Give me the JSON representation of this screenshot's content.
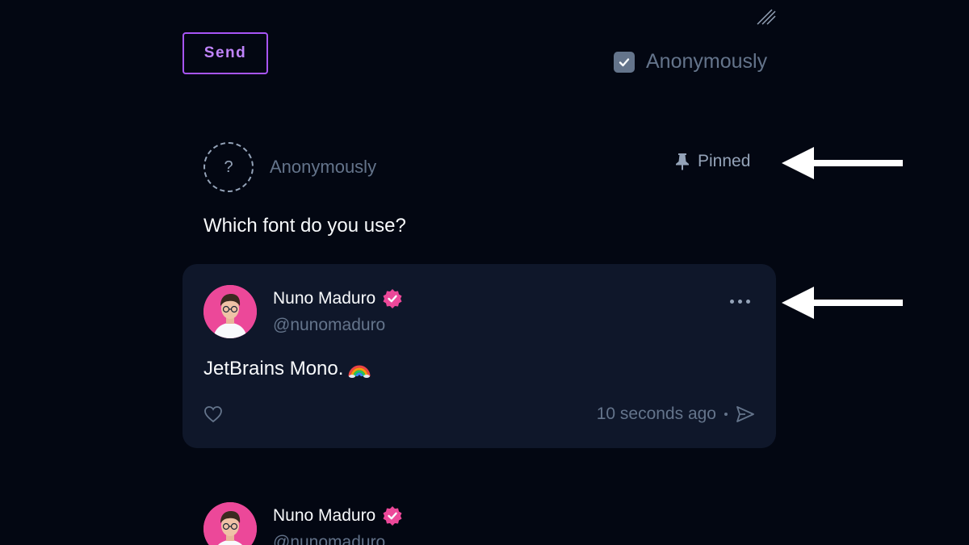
{
  "composer": {
    "send_label": "Send",
    "anonymous_label": "Anonymously",
    "anonymous_checked": true
  },
  "question": {
    "avatar_glyph": "?",
    "author": "Anonymously",
    "pinned_label": "Pinned",
    "text": "Which font do you use?"
  },
  "answer": {
    "author_name": "Nuno Maduro",
    "author_handle": "@nunomaduro",
    "text": "JetBrains Mono.",
    "emoji": "rainbow",
    "timestamp": "10 seconds ago"
  },
  "next_post": {
    "author_name": "Nuno Maduro",
    "author_handle": "@nunomaduro"
  },
  "colors": {
    "background": "#030712",
    "card": "#0f172a",
    "accent": "#a855f7",
    "verified": "#ec4899"
  }
}
